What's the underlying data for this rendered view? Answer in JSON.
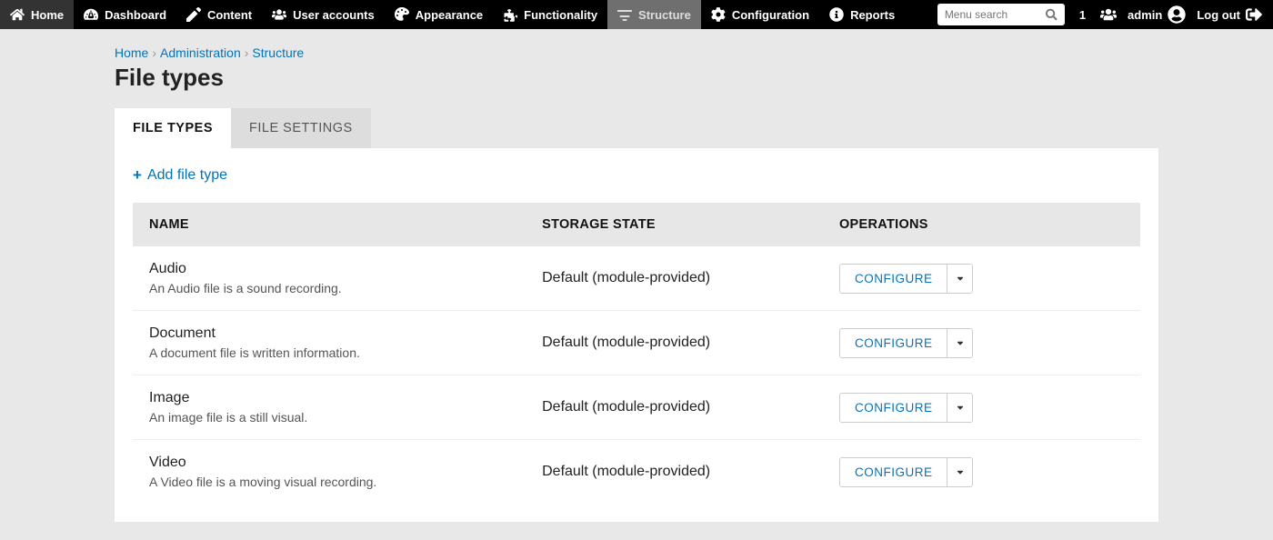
{
  "adminBar": {
    "left": [
      {
        "label": "Home",
        "icon": "house"
      },
      {
        "label": "Dashboard",
        "icon": "gauge"
      },
      {
        "label": "Content",
        "icon": "pencil"
      },
      {
        "label": "User accounts",
        "icon": "users"
      },
      {
        "label": "Appearance",
        "icon": "palette"
      },
      {
        "label": "Functionality",
        "icon": "puzzle"
      },
      {
        "label": "Structure",
        "icon": "sort",
        "active": true
      },
      {
        "label": "Configuration",
        "icon": "gear"
      },
      {
        "label": "Reports",
        "icon": "info"
      }
    ],
    "searchPlaceholder": "Menu search",
    "userCount": "1",
    "userName": "admin",
    "logoutLabel": "Log out"
  },
  "breadcrumb": [
    {
      "label": "Home",
      "link": true
    },
    {
      "label": "Administration",
      "link": true
    },
    {
      "label": "Structure",
      "link": true
    }
  ],
  "pageTitle": "File types",
  "tabs": [
    {
      "label": "FILE TYPES",
      "active": true
    },
    {
      "label": "FILE SETTINGS",
      "active": false
    }
  ],
  "addLinkLabel": "Add file type",
  "table": {
    "headers": {
      "name": "NAME",
      "storage": "STORAGE STATE",
      "operations": "OPERATIONS"
    },
    "configureLabel": "CONFIGURE",
    "rows": [
      {
        "name": "Audio",
        "desc": "An Audio file is a sound recording.",
        "storage": "Default (module-provided)"
      },
      {
        "name": "Document",
        "desc": "A document file is written information.",
        "storage": "Default (module-provided)"
      },
      {
        "name": "Image",
        "desc": "An image file is a still visual.",
        "storage": "Default (module-provided)"
      },
      {
        "name": "Video",
        "desc": "A Video file is a moving visual recording.",
        "storage": "Default (module-provided)"
      }
    ]
  }
}
